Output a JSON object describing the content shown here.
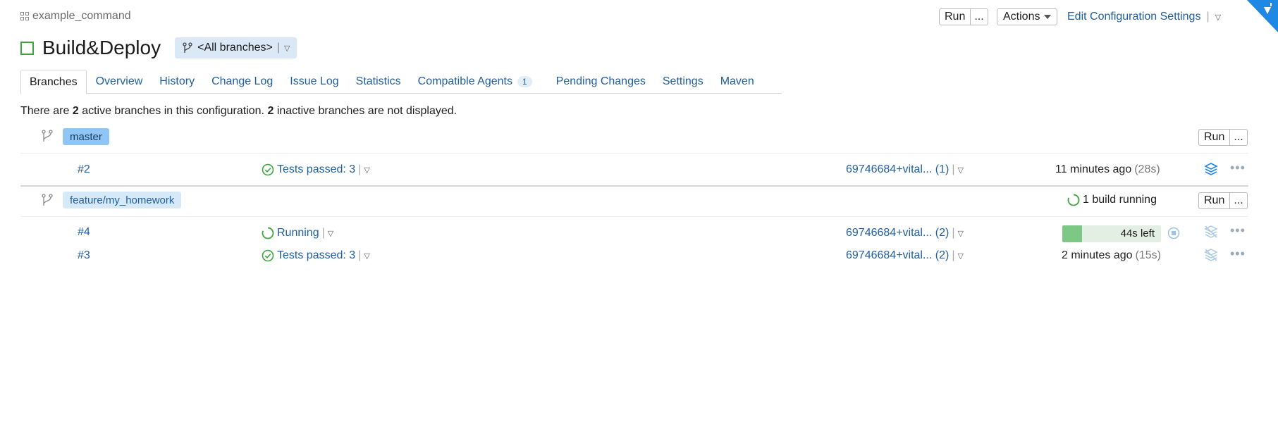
{
  "breadcrumb": {
    "project": "example_command",
    "icon": "grid-icon"
  },
  "header": {
    "run_label": "Run",
    "run_more_label": "...",
    "actions_label": "Actions",
    "edit_settings_label": "Edit Configuration Settings",
    "title": "Build&Deploy",
    "branch_selector": "<All branches>"
  },
  "tabs": [
    {
      "label": "Branches",
      "active": true
    },
    {
      "label": "Overview"
    },
    {
      "label": "History"
    },
    {
      "label": "Change Log"
    },
    {
      "label": "Issue Log"
    },
    {
      "label": "Statistics"
    },
    {
      "label": "Compatible Agents",
      "badge": "1"
    },
    {
      "label": "Pending Changes"
    },
    {
      "label": "Settings"
    },
    {
      "label": "Maven"
    }
  ],
  "summary": {
    "prefix": "There are",
    "active_count": "2",
    "middle": "active branches in this configuration.",
    "inactive_count": "2",
    "suffix": "inactive branches are not displayed."
  },
  "branches": [
    {
      "name": "master",
      "run_label": "Run",
      "run_more_label": "...",
      "status": "",
      "builds": [
        {
          "number": "#2",
          "status": "Tests passed: 3",
          "changes": "69746684+vital... (1)",
          "time": "11 minutes ago",
          "duration": "(28s)"
        }
      ]
    },
    {
      "name": "feature/my_homework",
      "run_label": "Run",
      "run_more_label": "...",
      "status": "1 build running",
      "builds": [
        {
          "number": "#4",
          "status": "Running",
          "changes": "69746684+vital... (2)",
          "progress_label": "44s left",
          "progress": 0.2
        },
        {
          "number": "#3",
          "status": "Tests passed: 3",
          "changes": "69746684+vital... (2)",
          "time": "2 minutes ago",
          "duration": "(15s)"
        }
      ]
    }
  ],
  "colors": {
    "link": "#1f5fa0",
    "success": "#3fa53f",
    "progress_fill": "#7ec886",
    "accent": "#1e88e5"
  }
}
